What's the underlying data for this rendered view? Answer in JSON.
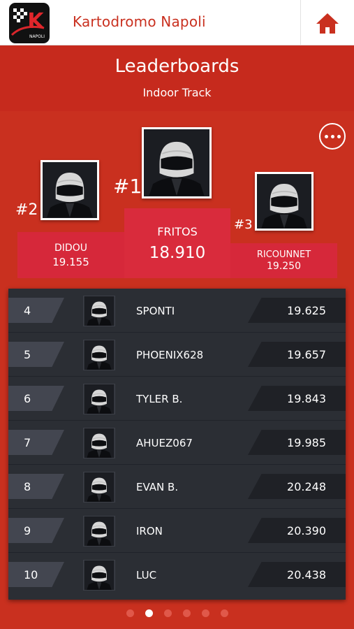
{
  "app": {
    "title": "Kartodromo Napoli",
    "logo_letter": "K",
    "logo_caption": "NAPOLI"
  },
  "header": {
    "title": "Leaderboards",
    "subtitle": "Indoor Track"
  },
  "podium": {
    "first": {
      "rank": "#1",
      "name": "FRITOS",
      "time": "18.910"
    },
    "second": {
      "rank": "#2",
      "name": "DIDOU",
      "time": "19.155"
    },
    "third": {
      "rank": "#3",
      "name": "RICOUNNET",
      "time": "19.250"
    }
  },
  "rows": [
    {
      "rank": "4",
      "name": "SPONTI",
      "time": "19.625"
    },
    {
      "rank": "5",
      "name": "PHOENIX628",
      "time": "19.657"
    },
    {
      "rank": "6",
      "name": "TYLER B.",
      "time": "19.843"
    },
    {
      "rank": "7",
      "name": "AHUEZ067",
      "time": "19.985"
    },
    {
      "rank": "8",
      "name": "EVAN B.",
      "time": "20.248"
    },
    {
      "rank": "9",
      "name": "IRON",
      "time": "20.390"
    },
    {
      "rank": "10",
      "name": "LUC",
      "time": "20.438"
    }
  ],
  "pager": {
    "total_pages": 6,
    "active_page": 2
  },
  "icons": {
    "home": "home-icon",
    "options": "more-options-icon",
    "avatar": "helmet-avatar-icon"
  },
  "colors": {
    "brand_red": "#c9301f",
    "podium_red": "#d6283a",
    "list_bg": "#2b2e34",
    "text_white": "#ffffff"
  }
}
